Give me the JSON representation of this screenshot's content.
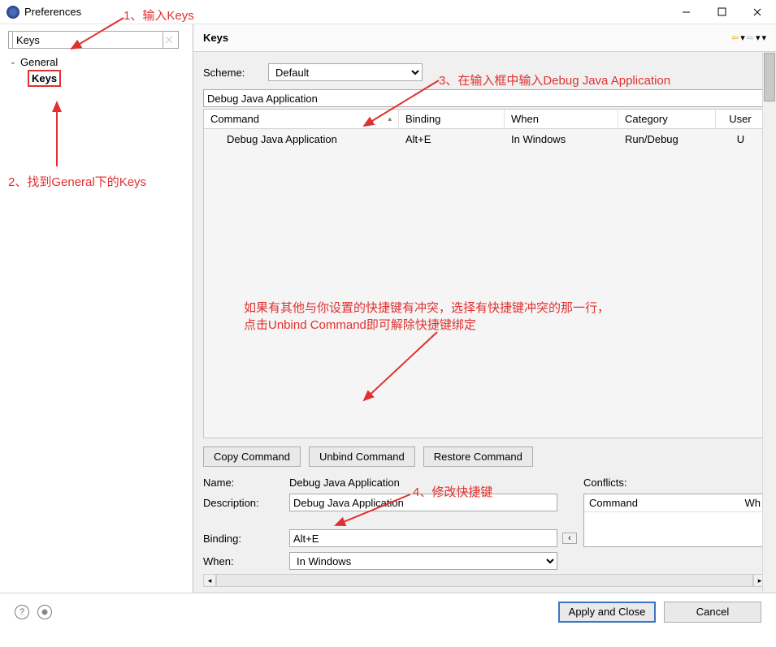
{
  "titlebar": {
    "title": "Preferences"
  },
  "sidebar": {
    "search": "Keys",
    "tree": {
      "parent": "General",
      "child": "Keys"
    }
  },
  "header": {
    "title": "Keys"
  },
  "scheme": {
    "label": "Scheme:",
    "value": "Default"
  },
  "filter": {
    "value": "Debug Java Application"
  },
  "grid": {
    "headers": {
      "command": "Command",
      "binding": "Binding",
      "when": "When",
      "category": "Category",
      "user": "User"
    },
    "rows": [
      {
        "command": "Debug Java Application",
        "binding": "Alt+E",
        "when": "In Windows",
        "category": "Run/Debug",
        "user": "U"
      }
    ]
  },
  "buttons": {
    "copy": "Copy Command",
    "unbind": "Unbind Command",
    "restore": "Restore Command"
  },
  "details": {
    "name_label": "Name:",
    "name_value": "Debug Java Application",
    "desc_label": "Description:",
    "desc_value": "Debug Java Application",
    "binding_label": "Binding:",
    "binding_value": "Alt+E",
    "when_label": "When:",
    "when_value": "In Windows",
    "conflicts_label": "Conflicts:",
    "conflicts_headers": {
      "command": "Command",
      "when": "Wh"
    }
  },
  "footer": {
    "apply": "Apply and Close",
    "cancel": "Cancel"
  },
  "annotations": {
    "a1": "1、输入Keys",
    "a2": "2、找到General下的Keys",
    "a3": "3、在输入框中输入Debug Java Application",
    "a4": "4、修改快捷键",
    "a5": "如果有其他与你设置的快捷键有冲突，选择有快捷键冲突的那一行，\n点击Unbind Command即可解除快捷键绑定"
  }
}
